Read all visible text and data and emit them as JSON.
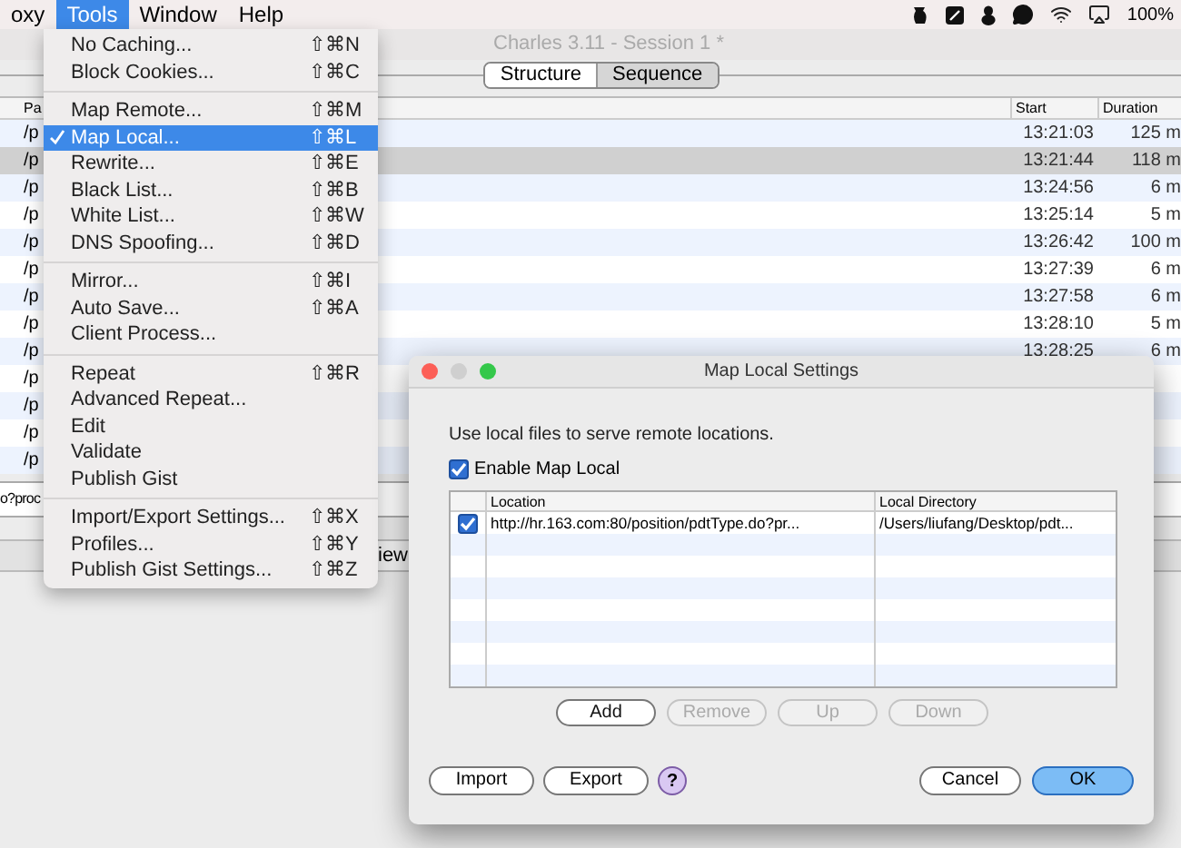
{
  "menubar": {
    "items": [
      {
        "label": "oxy",
        "selected": false
      },
      {
        "label": "Tools",
        "selected": true
      },
      {
        "label": "Window",
        "selected": false
      },
      {
        "label": "Help",
        "selected": false
      }
    ],
    "battery": "100%"
  },
  "window": {
    "title": "Charles 3.11 - Session 1 *"
  },
  "view_tabs": [
    {
      "label": "Structure",
      "selected": false
    },
    {
      "label": "Sequence",
      "selected": true
    }
  ],
  "table": {
    "columns": [
      "Pa",
      "Start",
      "Duration"
    ],
    "rows": [
      {
        "path": "/p",
        "start": "13:21:03",
        "duration": "125 m",
        "selected": false
      },
      {
        "path": "/p",
        "start": "13:21:44",
        "duration": "118 m",
        "selected": true
      },
      {
        "path": "/p",
        "start": "13:24:56",
        "duration": "6 m",
        "selected": false
      },
      {
        "path": "/p",
        "start": "13:25:14",
        "duration": "5 m",
        "selected": false
      },
      {
        "path": "/p",
        "start": "13:26:42",
        "duration": "100 m",
        "selected": false
      },
      {
        "path": "/p",
        "start": "13:27:39",
        "duration": "6 m",
        "selected": false
      },
      {
        "path": "/p",
        "start": "13:27:58",
        "duration": "6 m",
        "selected": false
      },
      {
        "path": "/p",
        "start": "13:28:10",
        "duration": "5 m",
        "selected": false
      },
      {
        "path": "/p",
        "start": "13:28:25",
        "duration": "6 m",
        "selected": false
      },
      {
        "path": "/p",
        "selected": false
      },
      {
        "path": "/p",
        "selected": false
      },
      {
        "path": "/p",
        "selected": false
      },
      {
        "path": "/p",
        "selected": false
      }
    ]
  },
  "filter_field": {
    "value": "o?proc"
  },
  "bottom_tab": {
    "label": "iew"
  },
  "tools_menu": {
    "groups": [
      [
        {
          "label": "No Caching...",
          "shortcut": "⇧⌘N",
          "checked": false,
          "selected": false
        },
        {
          "label": "Block Cookies...",
          "shortcut": "⇧⌘C",
          "checked": false,
          "selected": false
        }
      ],
      [
        {
          "label": "Map Remote...",
          "shortcut": "⇧⌘M",
          "checked": false,
          "selected": false
        },
        {
          "label": "Map Local...",
          "shortcut": "⇧⌘L",
          "checked": true,
          "selected": true
        },
        {
          "label": "Rewrite...",
          "shortcut": "⇧⌘E",
          "checked": false,
          "selected": false
        },
        {
          "label": "Black List...",
          "shortcut": "⇧⌘B",
          "checked": false,
          "selected": false
        },
        {
          "label": "White List...",
          "shortcut": "⇧⌘W",
          "checked": false,
          "selected": false
        },
        {
          "label": "DNS Spoofing...",
          "shortcut": "⇧⌘D",
          "checked": false,
          "selected": false
        }
      ],
      [
        {
          "label": "Mirror...",
          "shortcut": "⇧⌘I",
          "checked": false,
          "selected": false
        },
        {
          "label": "Auto Save...",
          "shortcut": "⇧⌘A",
          "checked": false,
          "selected": false
        },
        {
          "label": "Client Process...",
          "checked": false,
          "selected": false
        }
      ],
      [
        {
          "label": "Repeat",
          "shortcut": "⇧⌘R",
          "checked": false,
          "selected": false
        },
        {
          "label": "Advanced Repeat...",
          "checked": false,
          "selected": false
        },
        {
          "label": "Edit",
          "checked": false,
          "selected": false
        },
        {
          "label": "Validate",
          "checked": false,
          "selected": false
        },
        {
          "label": "Publish Gist",
          "checked": false,
          "selected": false
        }
      ],
      [
        {
          "label": "Import/Export Settings...",
          "shortcut": "⇧⌘X",
          "checked": false,
          "selected": false
        },
        {
          "label": "Profiles...",
          "shortcut": "⇧⌘Y",
          "checked": false,
          "selected": false
        },
        {
          "label": "Publish Gist Settings...",
          "shortcut": "⇧⌘Z",
          "checked": false,
          "selected": false
        }
      ]
    ]
  },
  "dialog": {
    "title": "Map Local Settings",
    "description": "Use local files to serve remote locations.",
    "enable": {
      "label": "Enable Map Local",
      "checked": true
    },
    "columns": [
      "Location",
      "Local Directory"
    ],
    "rows": [
      {
        "checked": true,
        "location": "http://hr.163.com:80/position/pdtType.do?pr...",
        "directory": "/Users/liufang/Desktop/pdt..."
      }
    ],
    "list_buttons": [
      {
        "label": "Add",
        "disabled": false
      },
      {
        "label": "Remove",
        "disabled": true
      },
      {
        "label": "Up",
        "disabled": true
      },
      {
        "label": "Down",
        "disabled": true
      }
    ],
    "left_buttons": [
      {
        "label": "Import"
      },
      {
        "label": "Export"
      }
    ],
    "help": "?",
    "right_buttons": [
      {
        "label": "Cancel",
        "default": false
      },
      {
        "label": "OK",
        "default": true
      }
    ]
  }
}
